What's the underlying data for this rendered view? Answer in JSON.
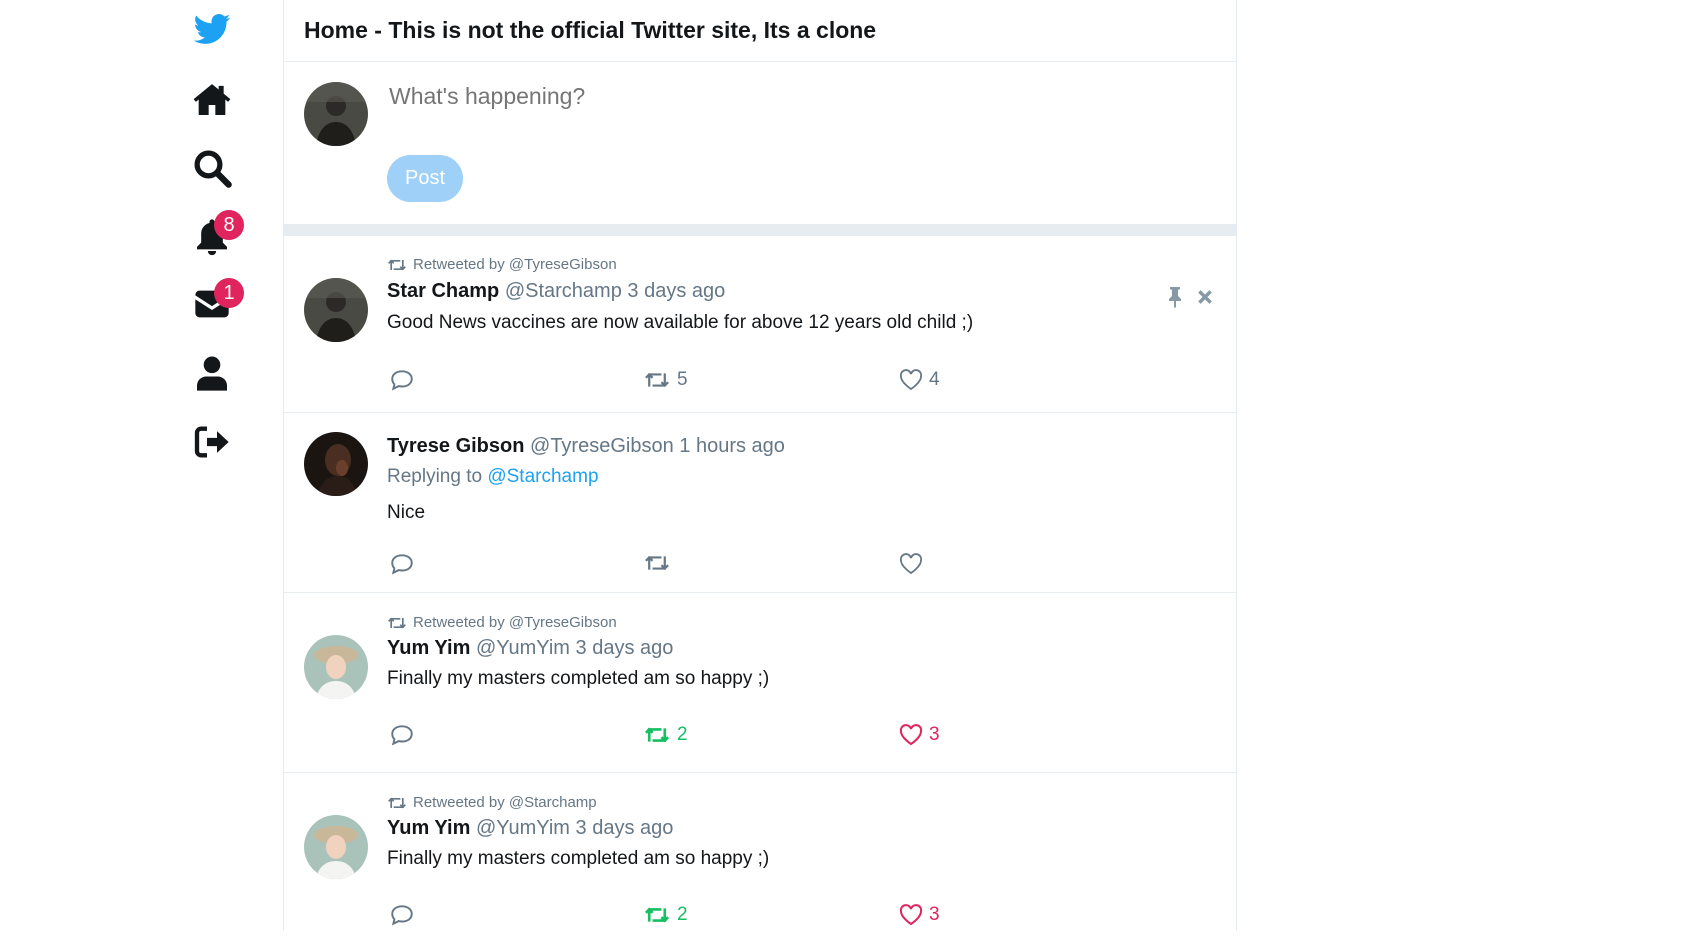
{
  "header": {
    "title": "Home - This is not the official Twitter site, Its a clone"
  },
  "nav": {
    "notifications_badge": "8",
    "messages_badge": "1"
  },
  "composer": {
    "placeholder": "What's happening?",
    "post_label": "Post"
  },
  "colors": {
    "accent": "#1da1f2",
    "like": "#e0245e",
    "retweet": "#17bf63",
    "muted": "#657786"
  },
  "tweets": [
    {
      "retweeted_by": "Retweeted by @TyreseGibson",
      "name": "Star Champ",
      "handle": "@Starchamp",
      "time": "3 days ago",
      "text": "Good News vaccines are now available for above 12 years old child ;)",
      "retweets": "5",
      "likes": "4"
    },
    {
      "name": "Tyrese Gibson",
      "handle": "@TyreseGibson",
      "time": "1 hours ago",
      "replying_prefix": "Replying to",
      "replying_to": "@Starchamp",
      "text": "Nice",
      "retweets": "",
      "likes": ""
    },
    {
      "retweeted_by": "Retweeted by @TyreseGibson",
      "name": "Yum Yim",
      "handle": "@YumYim",
      "time": "3 days ago",
      "text": "Finally my masters completed am so happy ;)",
      "retweets": "2",
      "likes": "3"
    },
    {
      "retweeted_by": "Retweeted by @Starchamp",
      "name": "Yum Yim",
      "handle": "@YumYim",
      "time": "3 days ago",
      "text": "Finally my masters completed am so happy ;)",
      "retweets": "2",
      "likes": "3"
    }
  ]
}
